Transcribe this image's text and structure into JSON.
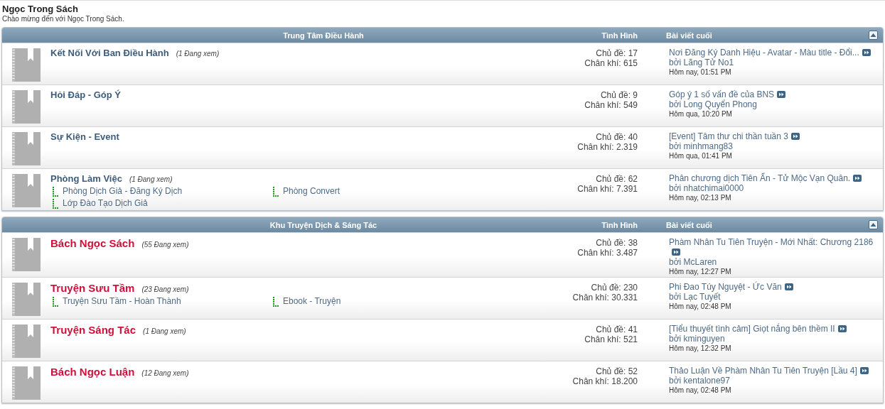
{
  "page": {
    "title": "Ngọc Trong Sách",
    "subtitle": "Chào mừng đến với Ngọc Trong Sách."
  },
  "sections": [
    {
      "title": "Trung Tâm Điều Hành",
      "stats_heading": "Tình Hình",
      "last_post_heading": "Bài viết cuối",
      "expanded": true,
      "forums": [
        {
          "name": "Kết Nối Với Ban Điều Hành",
          "featured": false,
          "viewers": "(1 Đang xem)",
          "topics": "Chủ đề: 17",
          "posts": "Chân khí: 615",
          "last_title": "Nơi Đăng Ký Danh Hiệu - Avatar - Màu title - Đổi...",
          "last_by": "bởi Lãng Tử No1",
          "last_time": "Hôm nay, 01:51 PM"
        },
        {
          "name": "Hỏi Đáp - Góp Ý",
          "featured": false,
          "topics": "Chủ đề: 9",
          "posts": "Chân khí: 549",
          "last_title": "Góp ý 1 số vấn đề của BNS",
          "last_by": "bởi Long Quyển Phong",
          "last_time": "Hôm qua, 10:20 PM"
        },
        {
          "name": "Sự Kiện - Event",
          "featured": false,
          "topics": "Chủ đề: 40",
          "posts": "Chân khí: 2.319",
          "last_title": "[Event] Tâm thư chi thần tuần 3",
          "last_by": "bởi minhmang83",
          "last_time": "Hôm qua, 01:41 PM"
        },
        {
          "name": "Phòng Làm Việc",
          "featured": false,
          "viewers": "(1 Đang xem)",
          "subforums": [
            "Phòng Dịch Giả - Đăng Ký Dịch",
            "Phòng Convert",
            "Lớp Đào Tạo Dịch Giả"
          ],
          "topics": "Chủ đề: 62",
          "posts": "Chân khí: 7.391",
          "last_title": "Phân chương dịch Tiên Ẩn - Tử Mộc Vạn Quân.",
          "last_by": "bởi nhatchimai0000",
          "last_time": "Hôm nay, 02:13 PM"
        }
      ]
    },
    {
      "title": "Khu Truyện Dịch & Sáng Tác",
      "stats_heading": "Tình Hình",
      "last_post_heading": "Bài viết cuối",
      "expanded": true,
      "forums": [
        {
          "name": "Bách Ngọc Sách",
          "featured": true,
          "viewers": "(55 Đang xem)",
          "topics": "Chủ đề: 38",
          "posts": "Chân khí: 3.487",
          "last_title": "Phàm Nhân Tu Tiên Truyện - Mới Nhất: Chương 2186",
          "last_by": "bởi McLaren",
          "last_time": "Hôm nay, 12:27 PM"
        },
        {
          "name": "Truyện Sưu Tầm",
          "featured": true,
          "viewers": "(23 Đang xem)",
          "subforums": [
            "Truyện Sưu Tầm - Hoàn Thành",
            "Ebook - Truyện"
          ],
          "topics": "Chủ đề: 230",
          "posts": "Chân khí: 30.331",
          "last_title": "Phi Đao Túy Nguyệt - Ức Văn",
          "last_by": "bởi Lạc Tuyết",
          "last_time": "Hôm nay, 02:48 PM"
        },
        {
          "name": "Truyện Sáng Tác",
          "featured": true,
          "viewers": "(1 Đang xem)",
          "topics": "Chủ đề: 41",
          "posts": "Chân khí: 521",
          "last_title": "[Tiểu thuyết tình cảm] Giọt nắng bên thềm II",
          "last_by": "bởi kminguyen",
          "last_time": "Hôm nay, 12:32 PM"
        },
        {
          "name": "Bách Ngọc Luận",
          "featured": true,
          "viewers": "(12 Đang xem)",
          "topics": "Chủ đề: 52",
          "posts": "Chân khí: 18.200",
          "last_title": "Thảo Luận Về Phàm Nhân Tu Tiên Truyện [Lầu 4]",
          "last_by": "bởi kentalone97",
          "last_time": "Hôm nay, 02:48 PM"
        }
      ]
    }
  ]
}
